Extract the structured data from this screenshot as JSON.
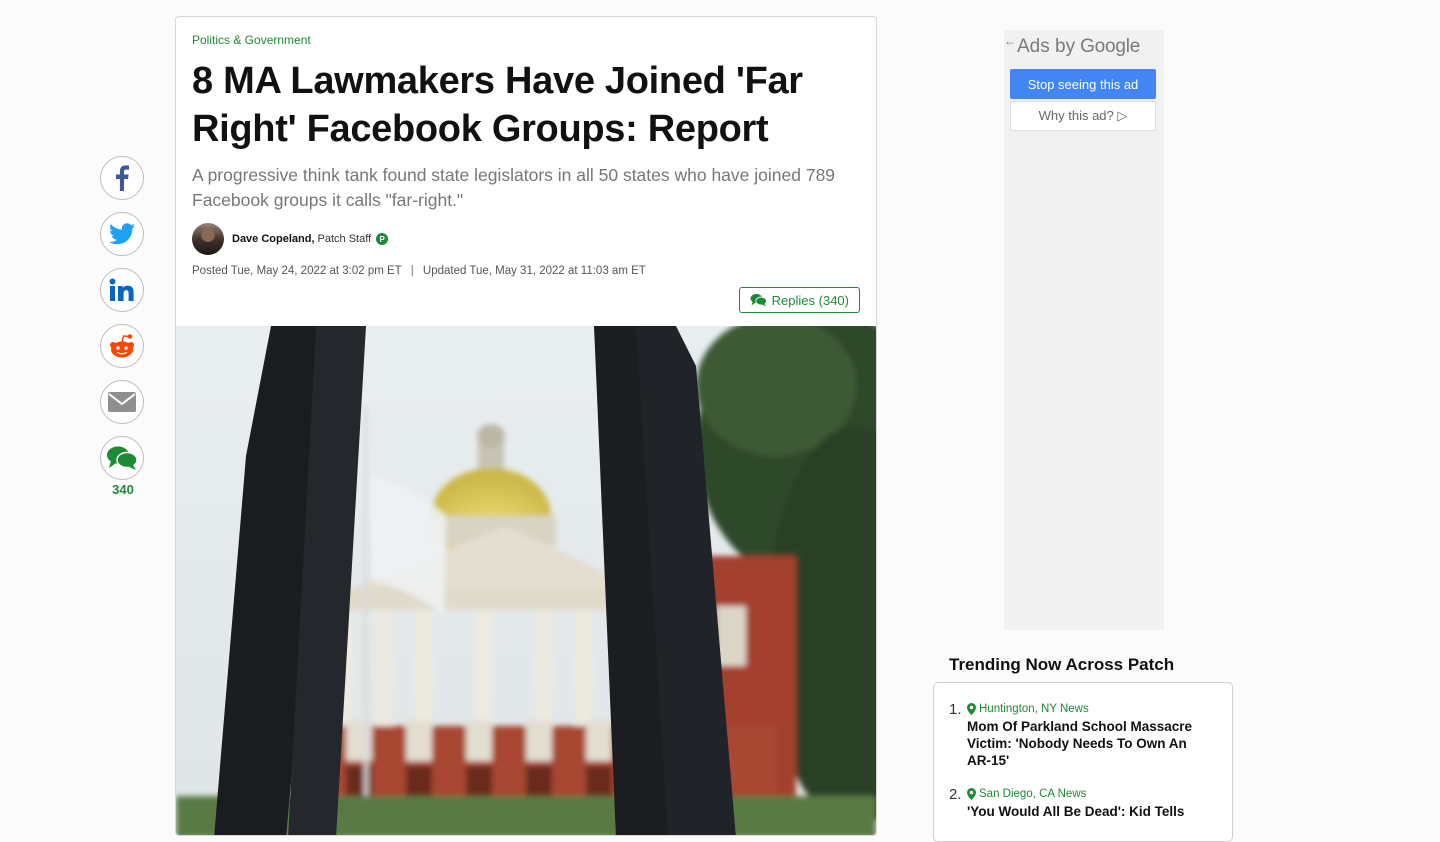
{
  "article": {
    "category": "Politics & Government",
    "headline": "8 MA Lawmakers Have Joined 'Far Right' Facebook Groups: Report",
    "dek": "A progressive think tank found state legislators in all 50 states who have joined 789 Facebook groups it calls \"far-right.\"",
    "author": "Dave Copeland,",
    "author_role": "Patch Staff",
    "author_badge": "P",
    "posted": "Posted Tue, May 24, 2022 at 3:02 pm ET",
    "separator": "|",
    "updated": "Updated Tue, May 31, 2022 at 11:03 am ET",
    "replies_label": "Replies (340)"
  },
  "share": {
    "buttons": [
      "facebook-icon",
      "twitter-icon",
      "linkedin-icon",
      "reddit-icon",
      "email-icon",
      "comments-icon"
    ],
    "comment_count": "340"
  },
  "ad": {
    "ads_by": "Ads by",
    "google": "Google",
    "stop_label": "Stop seeing this ad",
    "why_label": "Why this ad? ▷"
  },
  "trending": {
    "title": "Trending Now Across Patch",
    "items": [
      {
        "num": "1.",
        "location": "Huntington, NY News",
        "headline": "Mom Of Parkland School Massacre Victim: 'Nobody Needs To Own An AR-15'"
      },
      {
        "num": "2.",
        "location": "San Diego, CA News",
        "headline": "'You Would All Be Dead': Kid Tells"
      }
    ]
  },
  "colors": {
    "patch_green": "#1d8a35",
    "google_blue": "#4285f4",
    "facebook": "#3b5998",
    "twitter": "#1da1f2",
    "linkedin": "#0a66c2",
    "reddit": "#ff4500"
  }
}
